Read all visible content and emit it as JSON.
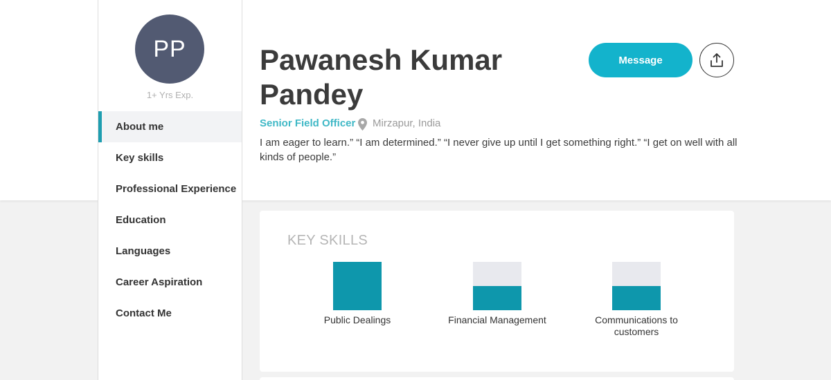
{
  "profile": {
    "initials": "PP",
    "experience": "1+ Yrs Exp.",
    "name": "Pawanesh Kumar Pandey",
    "role": "Senior Field Officer",
    "location": "Mirzapur, India",
    "bio": "I am eager to learn.” “I am determined.” “I never give up until I get something right.” “I get on well with all kinds of people.”"
  },
  "actions": {
    "message_label": "Message",
    "share_icon": "share-icon"
  },
  "nav": {
    "items": [
      {
        "label": "About me",
        "active": true
      },
      {
        "label": "Key skills",
        "active": false
      },
      {
        "label": "Professional Experience",
        "active": false
      },
      {
        "label": "Education",
        "active": false
      },
      {
        "label": "Languages",
        "active": false
      },
      {
        "label": "Career Aspiration",
        "active": false
      },
      {
        "label": "Contact Me",
        "active": false
      }
    ]
  },
  "key_skills": {
    "title": "KEY SKILLS",
    "skills": [
      {
        "label": "Public Dealings",
        "level": 1.0
      },
      {
        "label": "Financial Management",
        "level": 0.5
      },
      {
        "label": "Communications to customers",
        "level": 0.5
      }
    ]
  },
  "colors": {
    "accent": "#13b3cc",
    "skill_fill": "#0e97ac",
    "avatar_bg": "#525a72",
    "role_text": "#3fb8c6"
  }
}
